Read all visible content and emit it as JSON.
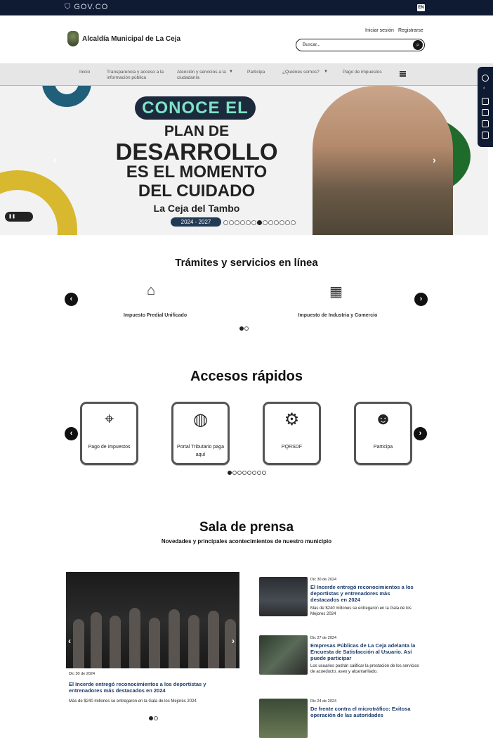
{
  "gov_bar": {
    "logo": "GOV.CO",
    "lang": "EN"
  },
  "header": {
    "site_title": "Alcaldía Municipal de La Ceja",
    "login": "Iniciar sesión",
    "register": "Registrarse",
    "search_placeholder": "Buscar..."
  },
  "nav": {
    "items": [
      {
        "label": "Inicio"
      },
      {
        "label": "Transparencia y acceso a la información pública"
      },
      {
        "label": "Atención y servicios a la ciudadanía"
      },
      {
        "label": "Participa"
      },
      {
        "label": "¿Quiénes somos?"
      },
      {
        "label": "Pago de impuestos"
      }
    ]
  },
  "hero": {
    "line1": "CONOCE EL",
    "line2": "PLAN DE",
    "line3": "DESARROLLO",
    "line4": "ES EL MOMENTO",
    "line5": "DEL CUIDADO",
    "line6": "La Ceja del Tambo",
    "years": "2024 - 2027",
    "slide_count": 13,
    "active_slide": 7
  },
  "tramites": {
    "title": "Trámites y servicios en línea",
    "items": [
      {
        "label": "Impuesto Predial Unificado",
        "icon": "home-icon"
      },
      {
        "label": "Impuesto de Industria y Comercio",
        "icon": "calculator-icon"
      }
    ],
    "pages": 2,
    "active_page": 1
  },
  "accesos": {
    "title": "Accesos rápidos",
    "items": [
      {
        "label": "Pago de impuestos",
        "icon": "pointer-click-icon"
      },
      {
        "label": "Portal Tributario paga aquí",
        "icon": "world-hand-icon"
      },
      {
        "label": "PQRSDF",
        "icon": "folder-gear-icon"
      },
      {
        "label": "Participa",
        "icon": "people-icon"
      }
    ],
    "pages": 8,
    "active_page": 1
  },
  "prensa": {
    "title": "Sala de prensa",
    "subtitle": "Novedades y principales acontecimientos de nuestro municipio",
    "featured": {
      "date": "Dic 30 de 2024",
      "headline": "El Incerde entregó reconocimientos a los deportistas y entrenadores más destacados en 2024",
      "summary": "Más de $240 millones se entregaron en la Gala de los Mejores 2024"
    },
    "list": [
      {
        "date": "Dic 30 de 2024",
        "headline": "El Incerde entregó reconocimientos a los deportistas y entrenadores más destacados en 2024",
        "summary": "Más de $240 millones se entregaron en la Gala de los Mejores 2024"
      },
      {
        "date": "Dic 27 de 2024",
        "headline": "Empresas Públicas de La Ceja adelanta la Encuesta de Satisfacción al Usuario. Así puede participar",
        "summary": "Los usuarios podrán calificar la prestación de los servicios de acueducto, aseo y alcantarillado."
      },
      {
        "date": "Dic 24 de 2024",
        "headline": "De frente contra el microtráfico: Exitosa operación de las autoridades",
        "summary": ""
      }
    ]
  },
  "colors": {
    "gov_bar": "#0f1b33",
    "nav_bg": "#e6e6e6",
    "headline_blue": "#1b3a6b",
    "hero_teal": "#7fe3c6"
  }
}
